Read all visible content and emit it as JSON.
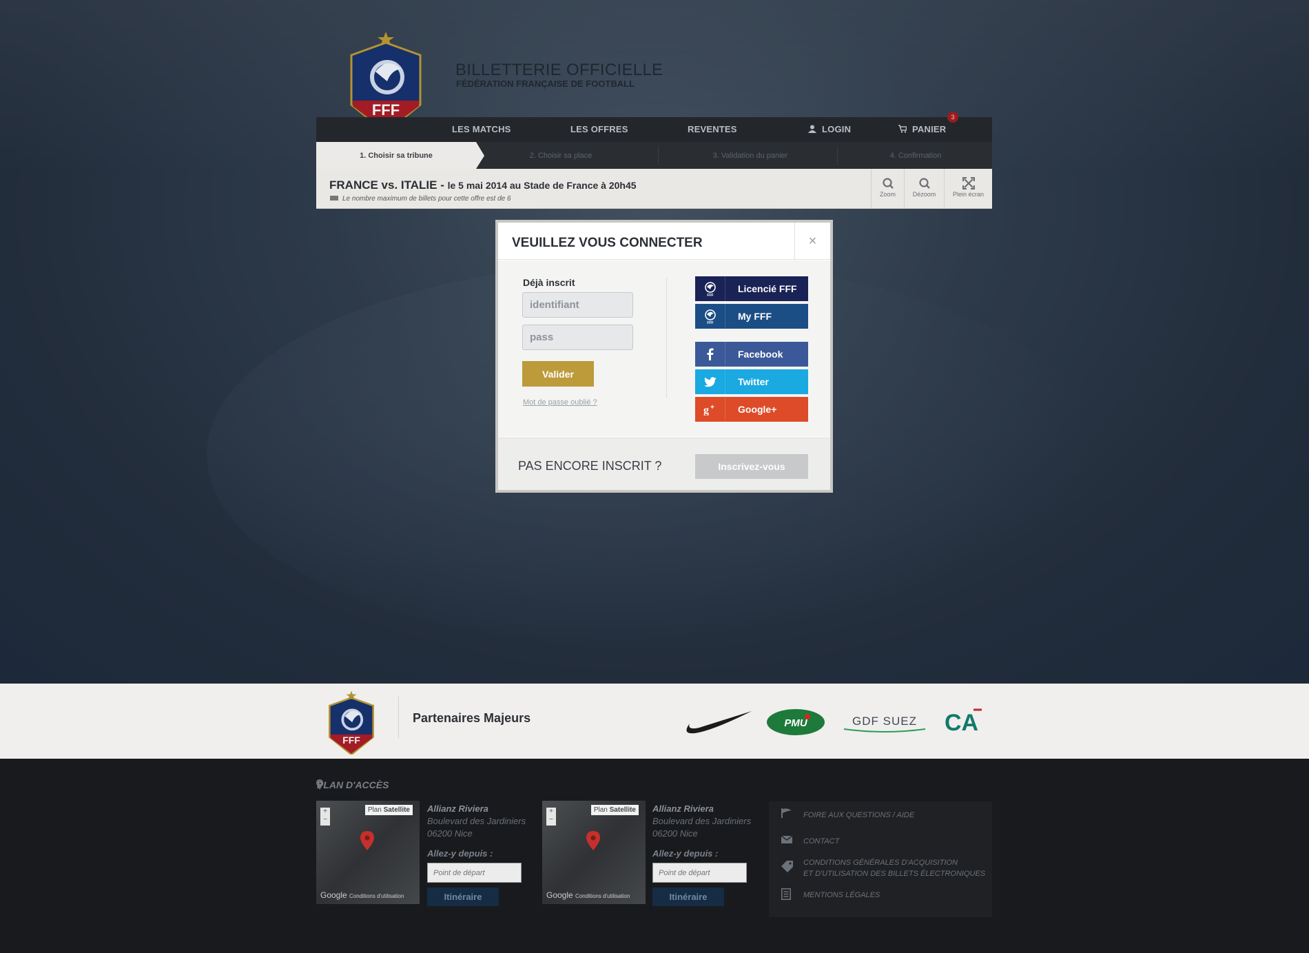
{
  "header": {
    "logo_text": "FFF",
    "title": "BILLETTERIE OFFICIELLE",
    "subtitle": "FÉDÉRATION FRANÇAISE DE FOOTBALL"
  },
  "nav": {
    "matches": "LES MATCHS",
    "offers": "LES OFFRES",
    "resales": "REVENTES",
    "login": "LOGIN",
    "cart": "PANIER",
    "cart_count": "3"
  },
  "steps": [
    {
      "label": "1. Choisir sa tribune"
    },
    {
      "label": "2. Choisir sa place"
    },
    {
      "label": "3. Validation du panier"
    },
    {
      "label": "4. Confirmation"
    }
  ],
  "match": {
    "title": "FRANCE vs. ITALIE - ",
    "detail": "le 5 mai 2014 au Stade de France à 20h45",
    "note": "Le nombre maximum de billets pour cette offre est de 6"
  },
  "tools": {
    "zoom": "Zoom",
    "dezoom": "Dézoom",
    "fullscreen": "Plein écran"
  },
  "modal": {
    "title": "VEUILLEZ VOUS CONNECTER",
    "close": "×",
    "already": "Déjà inscrit",
    "id_placeholder": "identifiant",
    "pass_placeholder": "pass",
    "validate": "Valider",
    "forgot": "Mot de passe oublié ?",
    "social": {
      "licencie": "Licencié FFF",
      "myfff": "My FFF",
      "facebook": "Facebook",
      "twitter": "Twitter",
      "google": "Google+"
    },
    "not_registered": "PAS ENCORE INSCRIT ?",
    "register": "Inscrivez-vous"
  },
  "colors": {
    "licencie": "#1a2356",
    "myfff": "#1c4e86",
    "facebook": "#3b5998",
    "twitter": "#1aa9e1",
    "google": "#dd4b28",
    "gold": "#bd9a3a"
  },
  "partners": {
    "title": "Partenaires Majeurs",
    "logo_text": "FFF",
    "sponsors": [
      "nike",
      "PMU",
      "GDF SUEZ",
      "CA"
    ]
  },
  "footer": {
    "plan_title": "PLAN D'ACCÈS",
    "venues": [
      {
        "name": "Allianz Riviera",
        "street": "Boulevard des Jardiniers",
        "city": "06200 Nice",
        "allez": "Allez-y depuis :",
        "placeholder": "Point de départ",
        "button": "Itinéraire",
        "map_plan": "Plan",
        "map_sat": "Satellite",
        "map_brand": "Google",
        "map_terms": "Conditions d'utilisation"
      },
      {
        "name": "Allianz Riviera",
        "street": "Boulevard des Jardiniers",
        "city": "06200 Nice",
        "allez": "Allez-y depuis :",
        "placeholder": "Point de départ",
        "button": "Itinéraire",
        "map_plan": "Plan",
        "map_sat": "Satellite",
        "map_brand": "Google",
        "map_terms": "Conditions d'utilisation"
      }
    ],
    "links": {
      "faq": "FOIRE AUX QUESTIONS / AIDE",
      "contact": "CONTACT",
      "cgv1": "CONDITIONS GÉNÉRALES D'ACQUISITION",
      "cgv2": "ET D'UTILISATION DES BILLETS ÉLECTRONIQUES",
      "legal": "MENTIONS LÉGALES"
    }
  }
}
